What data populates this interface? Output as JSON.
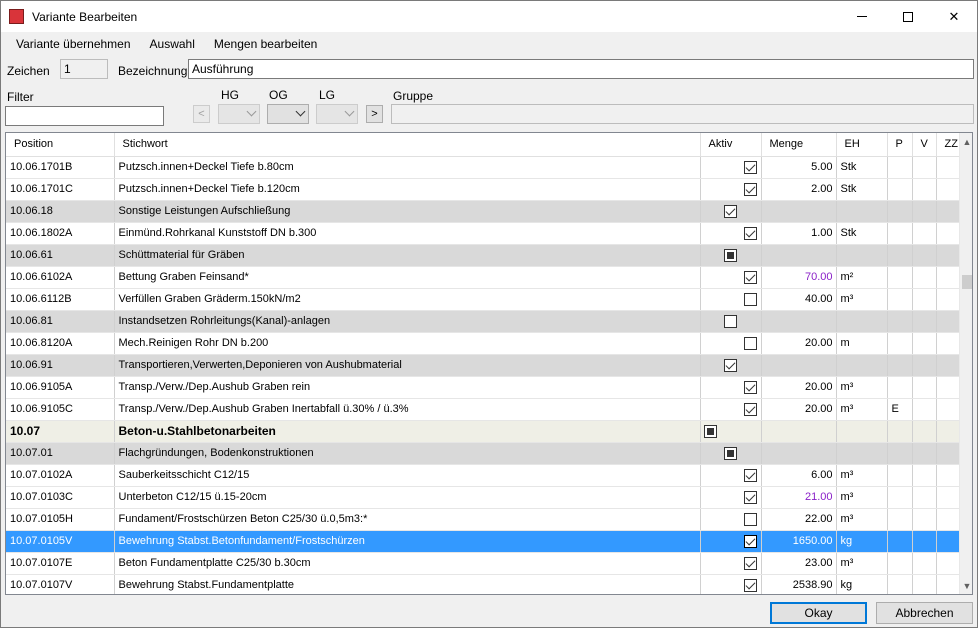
{
  "window": {
    "title": "Variante Bearbeiten"
  },
  "menu": [
    "Variante übernehmen",
    "Auswahl",
    "Mengen bearbeiten"
  ],
  "fields": {
    "zeichen_label": "Zeichen",
    "zeichen_value": "1",
    "bezeichnung_label": "Bezeichnung",
    "bezeichnung_value": "Ausführung",
    "filter_label": "Filter",
    "filter_value": "",
    "hg_label": "HG",
    "og_label": "OG",
    "lg_label": "LG",
    "gruppe_label": "Gruppe",
    "gruppe_value": "",
    "prev_glyph": "<",
    "next_glyph": ">"
  },
  "table": {
    "columns": [
      "Position",
      "Stichwort",
      "Aktiv",
      "Menge",
      "EH",
      "P",
      "V",
      "ZZ"
    ],
    "rows": [
      {
        "type": "item",
        "pos": "10.06.1701B",
        "text": "Putzsch.innen+Deckel Tiefe b.80cm",
        "aktiv": "checked",
        "menge": "5.00",
        "eh": "Stk",
        "p": "",
        "purple": false
      },
      {
        "type": "item",
        "pos": "10.06.1701C",
        "text": "Putzsch.innen+Deckel Tiefe b.120cm",
        "aktiv": "checked",
        "menge": "2.00",
        "eh": "Stk",
        "p": "",
        "purple": false
      },
      {
        "type": "group",
        "pos": "10.06.18",
        "text": "Sonstige Leistungen Aufschließung",
        "aktiv": "checked",
        "menge": "",
        "eh": "",
        "p": "",
        "purple": false
      },
      {
        "type": "item",
        "pos": "10.06.1802A",
        "text": "Einmünd.Rohrkanal Kunststoff DN b.300",
        "aktiv": "checked",
        "menge": "1.00",
        "eh": "Stk",
        "p": "",
        "purple": false
      },
      {
        "type": "group",
        "pos": "10.06.61",
        "text": "Schüttmaterial für Gräben",
        "aktiv": "indet",
        "menge": "",
        "eh": "",
        "p": "",
        "purple": false
      },
      {
        "type": "item",
        "pos": "10.06.6102A",
        "text": "Bettung Graben Feinsand*",
        "aktiv": "checked",
        "menge": "70.00",
        "eh": "m²",
        "p": "",
        "purple": true
      },
      {
        "type": "item",
        "pos": "10.06.6112B",
        "text": "Verfüllen Graben Gräderm.150kN/m2",
        "aktiv": "unchecked",
        "menge": "40.00",
        "eh": "m³",
        "p": "",
        "purple": false
      },
      {
        "type": "group",
        "pos": "10.06.81",
        "text": "Instandsetzen Rohrleitungs(Kanal)-anlagen",
        "aktiv": "unchecked",
        "menge": "",
        "eh": "",
        "p": "",
        "purple": false
      },
      {
        "type": "item",
        "pos": "10.06.8120A",
        "text": "Mech.Reinigen Rohr DN b.200",
        "aktiv": "unchecked",
        "menge": "20.00",
        "eh": "m",
        "p": "",
        "purple": false
      },
      {
        "type": "group",
        "pos": "10.06.91",
        "text": "Transportieren,Verwerten,Deponieren von Aushubmaterial",
        "aktiv": "checked",
        "menge": "",
        "eh": "",
        "p": "",
        "purple": false
      },
      {
        "type": "item",
        "pos": "10.06.9105A",
        "text": "Transp./Verw./Dep.Aushub Graben rein",
        "aktiv": "checked",
        "menge": "20.00",
        "eh": "m³",
        "p": "",
        "purple": false
      },
      {
        "type": "item",
        "pos": "10.06.9105C",
        "text": "Transp./Verw./Dep.Aushub Graben Inertabfall ü.30% / ü.3%",
        "aktiv": "checked",
        "menge": "20.00",
        "eh": "m³",
        "p": "E",
        "purple": false
      },
      {
        "type": "main",
        "pos": "10.07",
        "text": "Beton-u.Stahlbetonarbeiten",
        "aktiv": "indet",
        "menge": "",
        "eh": "",
        "p": "",
        "purple": false
      },
      {
        "type": "group",
        "pos": "10.07.01",
        "text": "Flachgründungen, Bodenkonstruktionen",
        "aktiv": "indet",
        "menge": "",
        "eh": "",
        "p": "",
        "purple": false
      },
      {
        "type": "item",
        "pos": "10.07.0102A",
        "text": "Sauberkeitsschicht C12/15",
        "aktiv": "checked",
        "menge": "6.00",
        "eh": "m³",
        "p": "",
        "purple": false
      },
      {
        "type": "item",
        "pos": "10.07.0103C",
        "text": "Unterbeton C12/15 ü.15-20cm",
        "aktiv": "checked",
        "menge": "21.00",
        "eh": "m³",
        "p": "",
        "purple": true
      },
      {
        "type": "item",
        "pos": "10.07.0105H",
        "text": "Fundament/Frostschürzen Beton C25/30 ü.0,5m3:*",
        "aktiv": "unchecked",
        "menge": "22.00",
        "eh": "m³",
        "p": "",
        "purple": false
      },
      {
        "type": "selected",
        "pos": "10.07.0105V",
        "text": "Bewehrung Stabst.Betonfundament/Frostschürzen",
        "aktiv": "checked",
        "menge": "1650.00",
        "eh": "kg",
        "p": "",
        "purple": false
      },
      {
        "type": "item",
        "pos": "10.07.0107E",
        "text": "Beton Fundamentplatte C25/30 b.30cm",
        "aktiv": "checked",
        "menge": "23.00",
        "eh": "m³",
        "p": "",
        "purple": false
      },
      {
        "type": "item",
        "pos": "10.07.0107V",
        "text": "Bewehrung Stabst.Fundamentplatte",
        "aktiv": "checked",
        "menge": "2538.90",
        "eh": "kg",
        "p": "",
        "purple": false
      }
    ]
  },
  "buttons": {
    "okay": "Okay",
    "abbrechen": "Abbrechen"
  },
  "colors": {
    "selection": "#3399ff",
    "purple_value": "#8a20c8",
    "group_bg": "#d9d9d9",
    "main_bg": "#efefe6",
    "default_border": "#0078d7"
  }
}
